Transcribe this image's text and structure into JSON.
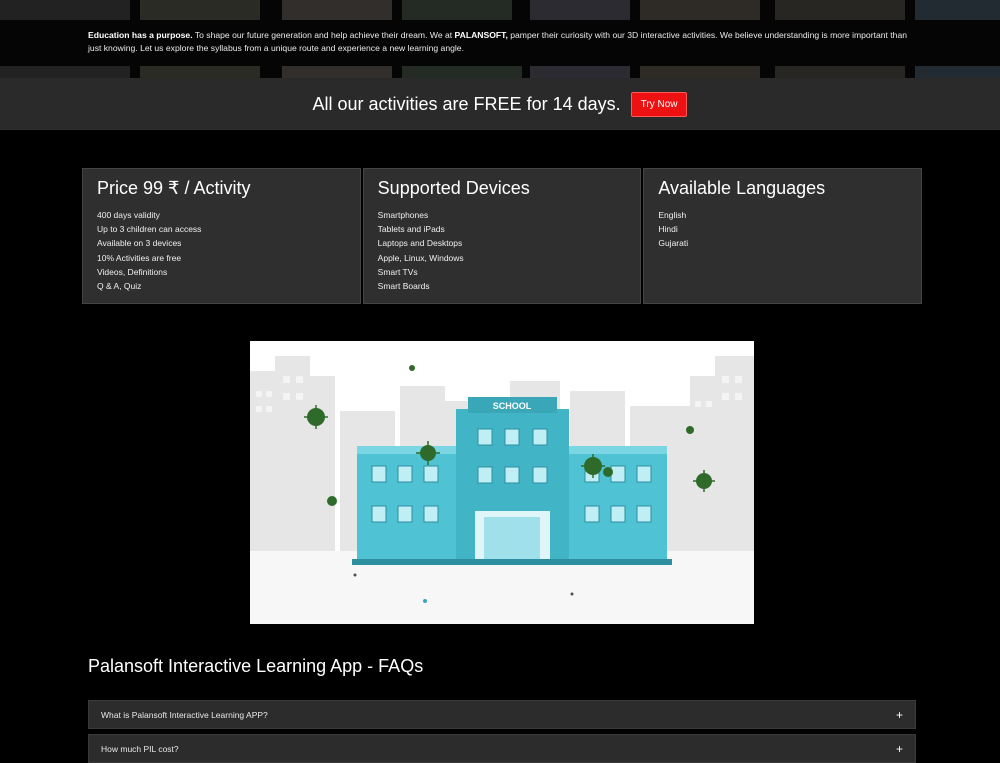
{
  "hero": {
    "intro_bold": "Education has a purpose.",
    "intro_text_1": " To shape our future generation and help achieve their dream. We at ",
    "brand": "PALANSOFT,",
    "intro_text_2": " pamper their curiosity with our 3D interactive activities. We believe understanding is more important than just knowing. Let us explore the syllabus from a unique route and experience a new learning angle."
  },
  "promo": {
    "text": "All our activities are FREE for 14 days.",
    "button_label": "Try Now",
    "button_color": "#ee1111"
  },
  "cards": [
    {
      "title": "Price 99 ₹ / Activity",
      "items": [
        "400 days validity",
        "Up to 3 children can access",
        "Available on 3 devices",
        "10% Activities are free",
        "Videos, Definitions",
        "Q & A, Quiz"
      ]
    },
    {
      "title": "Supported Devices",
      "items": [
        "Smartphones",
        "Tablets and iPads",
        "Laptops and Desktops",
        "Apple, Linux, Windows",
        "Smart TVs",
        "Smart Boards"
      ]
    },
    {
      "title": "Available Languages",
      "items": [
        "English",
        "Hindi",
        "Gujarati"
      ]
    }
  ],
  "illustration": {
    "sign_text": "SCHOOL"
  },
  "faq": {
    "title": "Palansoft Interactive Learning App - FAQs",
    "items": [
      {
        "question": "What is Palansoft Interactive Learning APP?"
      },
      {
        "question": "How much PIL cost?"
      }
    ]
  }
}
